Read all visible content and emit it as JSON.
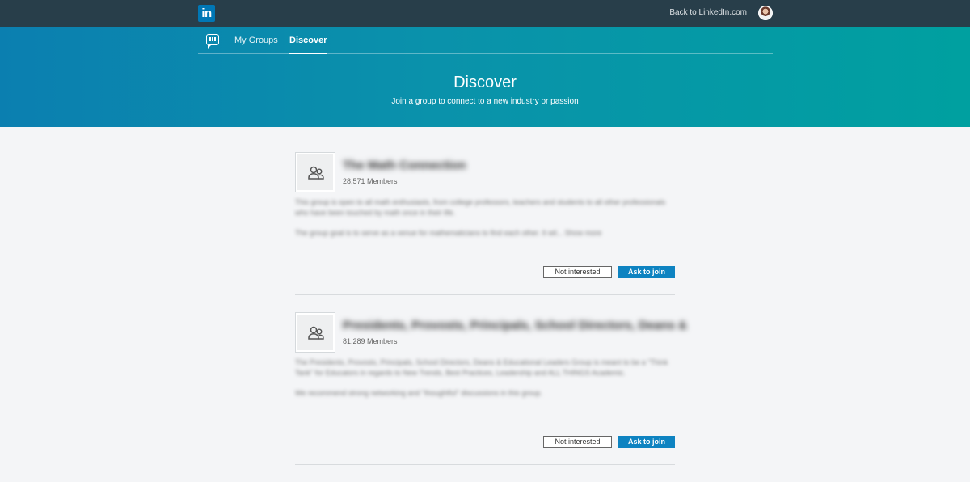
{
  "topbar": {
    "logo_text": "in",
    "back_link": "Back to LinkedIn.com",
    "avatar_icon": "profile-photo"
  },
  "subnav": {
    "icon": "groups-chat-icon",
    "tabs": [
      {
        "label": "My Groups",
        "active": false
      },
      {
        "label": "Discover",
        "active": true
      }
    ]
  },
  "hero": {
    "title": "Discover",
    "subtitle": "Join a group to connect to a new industry or passion"
  },
  "groups": [
    {
      "name": "The Math Connection",
      "members": "28,571 Members",
      "description": [
        "This group is open to all math enthusiasts, from college professors, teachers and students to all other professionals who have been touched by math once in their life.",
        "The group goal is to serve as a venue for mathematicians to find each other. It wil... Show more"
      ],
      "not_interested_label": "Not interested",
      "join_label": "Ask to join"
    },
    {
      "name": "Presidents, Provosts, Principals, School Directors, Deans &",
      "members": "81,289 Members",
      "description": [
        "The Presidents, Provosts, Principals, School Directors, Deans & Educational Leaders Group is meant to be a \"Think Tank\" for Educators in regards to New Trends, Best Practices, Leadership and ALL THINGS Academic.",
        "We recommend strong networking and \"thoughtful\" discussions in this group."
      ],
      "not_interested_label": "Not interested",
      "join_label": "Ask to join"
    }
  ],
  "colors": {
    "topbar": "#283e4a",
    "hero_start": "#0b7fb0",
    "hero_end": "#00a0a0",
    "join_button": "#0e83c1",
    "page_bg": "#f4f5f7"
  }
}
